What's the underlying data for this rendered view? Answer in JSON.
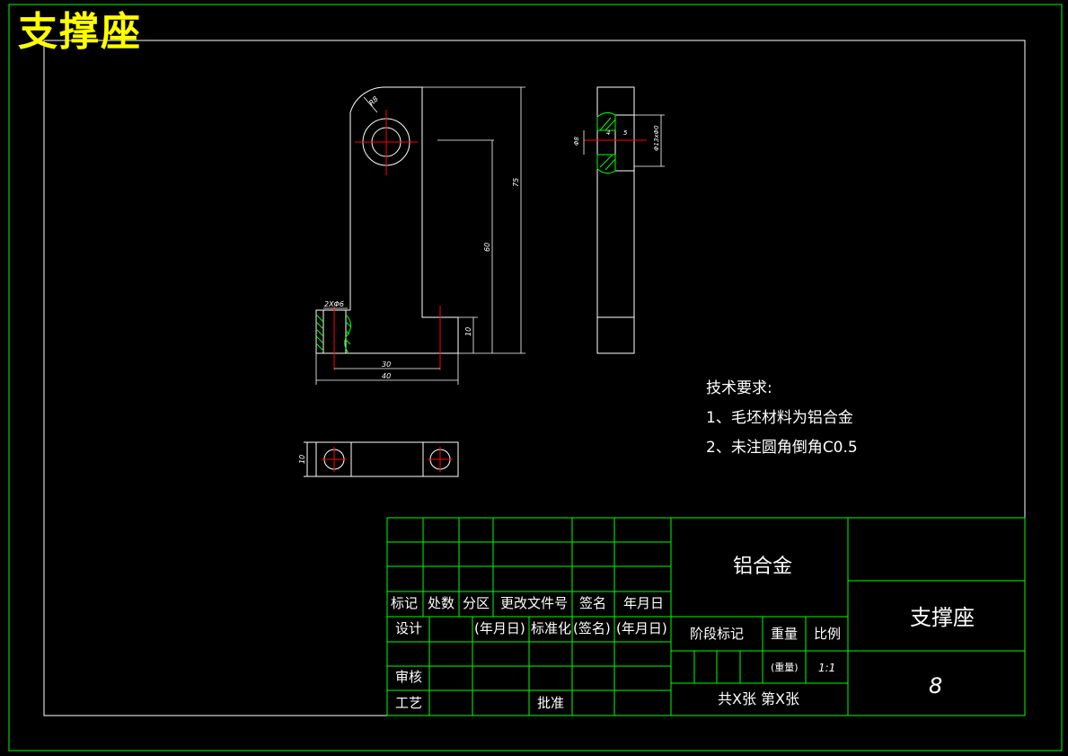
{
  "drawing": {
    "title": "支撑座",
    "tech_requirements": {
      "heading": "技术要求:",
      "items": [
        "1、毛坯材料为铝合金",
        "2、未注圆角倒角C0.5"
      ]
    },
    "dimensions": {
      "r_top": "R8",
      "h_total": "75",
      "h_hole": "60",
      "h_base": "10",
      "w_inner": "30",
      "w_outer": "40",
      "holes": "2XΦ6",
      "w_bottom_view": "10",
      "side_d1": "Φ8",
      "side_d2": "Φ13xΦ0",
      "side_w1": "4",
      "side_w2": "5"
    }
  },
  "title_block": {
    "material": "铝合金",
    "part_name": "支撑座",
    "drawing_no": "8",
    "headers": [
      "标记",
      "处数",
      "分区",
      "更改文件号",
      "签名",
      "年月日"
    ],
    "design_row": [
      "设计",
      "(年月日)",
      "标准化",
      "(签名)",
      "(年月日)"
    ],
    "review": "审核",
    "process": "工艺",
    "approve": "批准",
    "stage_mark": "阶段标记",
    "weight": "重量",
    "scale": "比例",
    "weight_value": "(重量)",
    "scale_value": "1:1",
    "sheets": "共X张 第X张"
  },
  "colors": {
    "border": "#00ff00",
    "line": "#ffffff",
    "center": "#ff0000",
    "hatch": "#00ff00",
    "title": "#ffff00"
  }
}
